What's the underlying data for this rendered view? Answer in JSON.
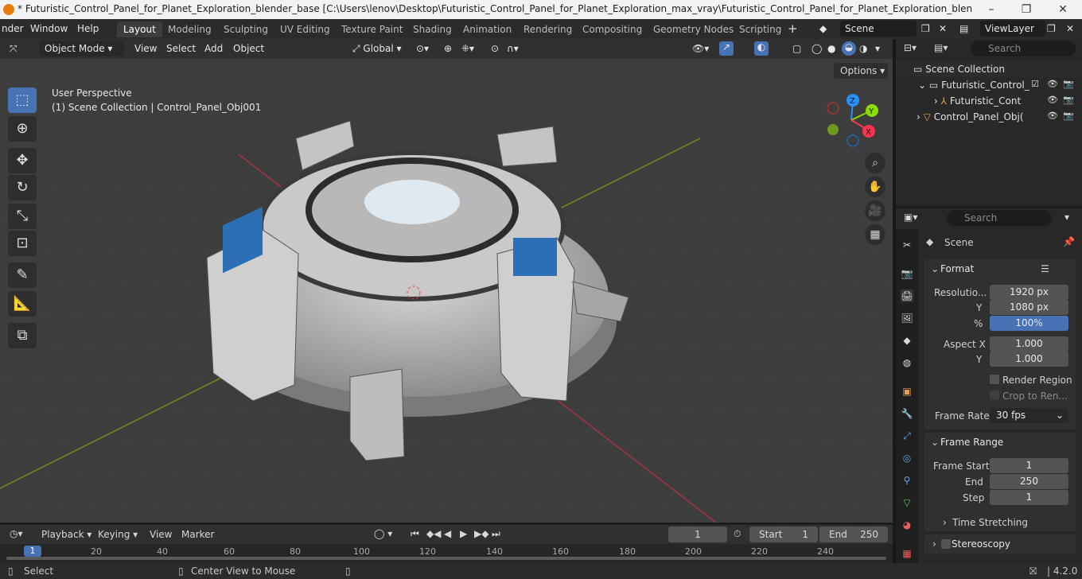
{
  "window": {
    "title": "* Futuristic_Control_Panel_for_Planet_Exploration_blender_base [C:\\Users\\lenov\\Desktop\\Futuristic_Control_Panel_for_Planet_Exploration_max_vray\\Futuristic_Control_Panel_for_Planet_Exploration_blender_base.blend] - Blend...",
    "controls": [
      "minimize",
      "restore",
      "close"
    ]
  },
  "menubar": {
    "items": [
      "nder",
      "Window",
      "Help"
    ],
    "workspaces": [
      "Layout",
      "Modeling",
      "Sculpting",
      "UV Editing",
      "Texture Paint",
      "Shading",
      "Animation",
      "Rendering",
      "Compositing",
      "Geometry Nodes",
      "Scripting"
    ],
    "active_workspace": "Layout",
    "scene": "Scene",
    "view_layer": "ViewLayer"
  },
  "viewport_header": {
    "mode": "Object Mode",
    "menus": [
      "View",
      "Select",
      "Add",
      "Object"
    ],
    "orientation": "Global",
    "options": "Options"
  },
  "viewport": {
    "perspective": "User Perspective",
    "collection_info": "(1) Scene Collection | Control_Panel_Obj001",
    "gizmo_axes": [
      "Z",
      "Y",
      "X"
    ]
  },
  "outliner": {
    "search_placeholder": "Search",
    "root": "Scene Collection",
    "items": [
      {
        "label": "Futuristic_Control_"
      },
      {
        "label": "Futuristic_Cont"
      },
      {
        "label": "Control_Panel_Obj("
      }
    ]
  },
  "properties": {
    "search_placeholder": "Search",
    "context": "Scene",
    "format_panel": "Format",
    "resolution_label": "Resolutio...",
    "res_x": "1920 px",
    "y_label": "Y",
    "res_y": "1080 px",
    "pct_label": "%",
    "pct": "100%",
    "aspect_x_label": "Aspect X",
    "aspect_x": "1.000",
    "aspect_y": "1.000",
    "render_region": "Render Region",
    "crop": "Crop to Ren...",
    "frame_rate_label": "Frame Rate",
    "frame_rate": "30 fps",
    "frame_range_panel": "Frame Range",
    "frame_start_label": "Frame Start",
    "frame_start": "1",
    "end_label": "End",
    "end": "250",
    "step_label": "Step",
    "step": "1",
    "time_stretching": "Time Stretching",
    "stereoscopy": "Stereoscopy"
  },
  "timeline": {
    "menus": [
      "Playback",
      "Keying",
      "View",
      "Marker"
    ],
    "current_frame": "1",
    "start_label": "Start",
    "start": "1",
    "end_label": "End",
    "end": "250",
    "ticks": [
      "1",
      "20",
      "40",
      "60",
      "80",
      "100",
      "120",
      "140",
      "160",
      "180",
      "200",
      "220",
      "240"
    ]
  },
  "statusbar": {
    "select": "Select",
    "center_view": "Center View to Mouse",
    "version": "4.2.0"
  },
  "colors": {
    "accent": "#4772b3",
    "x_axis": "#ff3352",
    "y_axis": "#8bdc00",
    "z_axis": "#2890ff"
  }
}
